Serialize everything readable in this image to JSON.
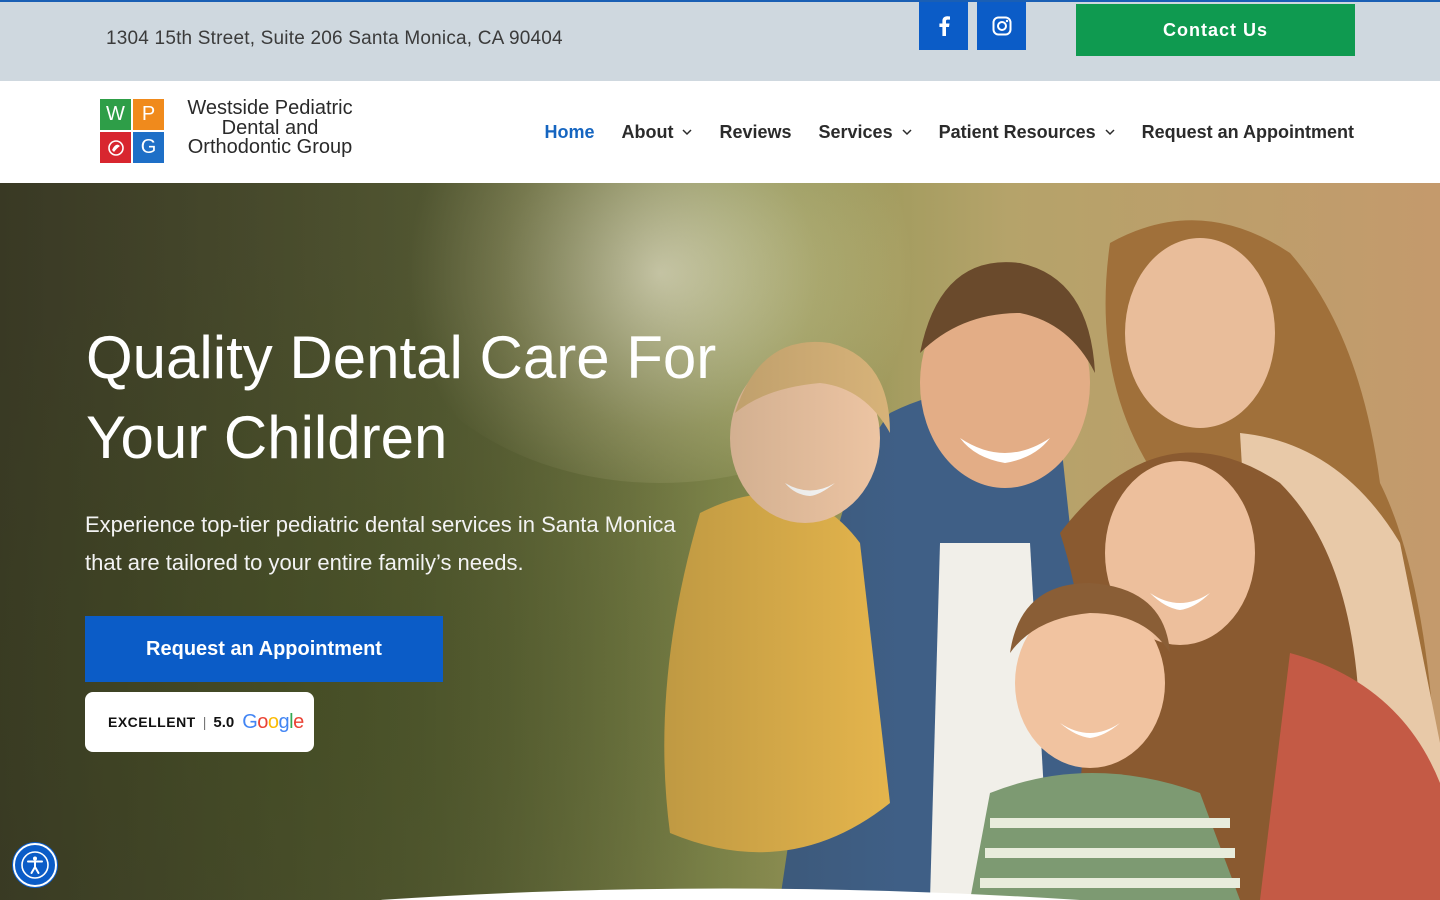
{
  "topbar": {
    "address": "1304 15th Street, Suite 206 Santa Monica, CA 90404",
    "social": [
      {
        "icon": "facebook-icon"
      },
      {
        "icon": "instagram-icon"
      }
    ],
    "contact_label": "Contact Us"
  },
  "logo": {
    "letters": [
      "W",
      "P",
      "",
      "G"
    ],
    "line1": "Westside Pediatric",
    "line2": "Dental and",
    "line3": "Orthodontic Group"
  },
  "nav": {
    "items": [
      {
        "label": "Home",
        "active": true,
        "dropdown": false
      },
      {
        "label": "About",
        "active": false,
        "dropdown": true
      },
      {
        "label": "Reviews",
        "active": false,
        "dropdown": false
      },
      {
        "label": "Services",
        "active": false,
        "dropdown": true
      },
      {
        "label": "Patient Resources",
        "active": false,
        "dropdown": true
      },
      {
        "label": "Request an Appointment",
        "active": false,
        "dropdown": false
      }
    ]
  },
  "hero": {
    "title_line1": "Quality Dental Care For",
    "title_line2": "Your Children",
    "subtitle_line1": "Experience top-tier pediatric dental services in Santa Monica",
    "subtitle_line2": "that are tailored to your entire family’s needs.",
    "cta_label": "Request an Appointment",
    "rating": {
      "label": "EXCELLENT",
      "separator": "|",
      "score": "5.0",
      "provider": [
        "G",
        "o",
        "o",
        "g",
        "l",
        "e"
      ]
    }
  },
  "colors": {
    "brand_blue": "#0b5cc7",
    "contact_green": "#0f9a50",
    "topbar_bg": "#cfd8df",
    "nav_active": "#1565c0"
  },
  "accessibility": {
    "icon": "accessibility-icon"
  }
}
